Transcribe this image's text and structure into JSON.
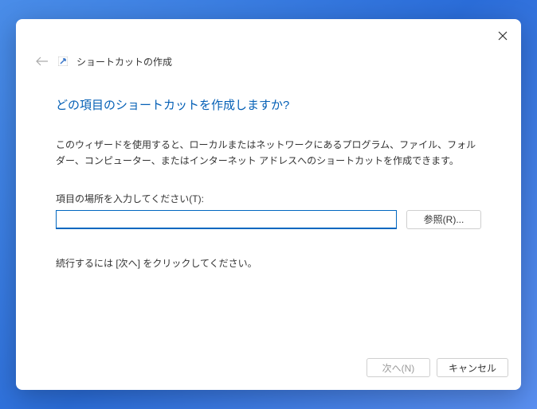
{
  "header": {
    "title": "ショートカットの作成"
  },
  "main": {
    "heading": "どの項目のショートカットを作成しますか?",
    "description": "このウィザードを使用すると、ローカルまたはネットワークにあるプログラム、ファイル、フォルダー、コンピューター、またはインターネット アドレスへのショートカットを作成できます。",
    "field_label": "項目の場所を入力してください(T):",
    "location_value": "",
    "browse_label": "参照(R)...",
    "continue_text": "続行するには [次へ] をクリックしてください。"
  },
  "footer": {
    "next_label": "次へ(N)",
    "cancel_label": "キャンセル"
  }
}
